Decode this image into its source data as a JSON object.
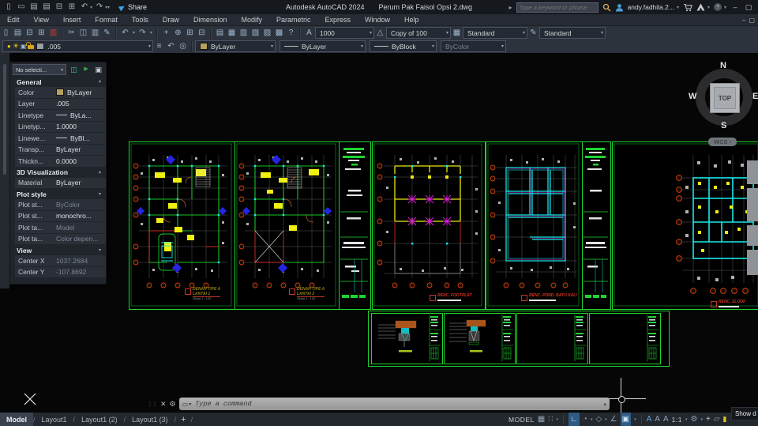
{
  "titlebar": {
    "share_label": "Share",
    "app_title": "Autodesk AutoCAD 2024",
    "doc_title": "Perum Pak Faisol Opsi 2.dwg",
    "search_placeholder": "Type a keyword or phrase",
    "user_name": "andy.fadhila.2..."
  },
  "menubar": {
    "items": [
      "Edit",
      "View",
      "Insert",
      "Format",
      "Tools",
      "Draw",
      "Dimension",
      "Modify",
      "Parametric",
      "Express",
      "Window",
      "Help"
    ]
  },
  "toolbar": {
    "dim_scale": "1000",
    "scale_list": "Copy of 100",
    "table_style": "Standard",
    "mleader_style": "Standard",
    "layer_name": ".005",
    "color": "ByLayer",
    "linetype": "ByLayer",
    "lineweight": "ByBlock",
    "plot_style": "ByColor"
  },
  "properties": {
    "selection": "No selecti...",
    "sections": [
      {
        "title": "General",
        "rows": [
          [
            "Color",
            "ByLayer"
          ],
          [
            "Layer",
            ".005"
          ],
          [
            "Linetype",
            "ByLa..."
          ],
          [
            "Linetyp...",
            "1.0000"
          ],
          [
            "Linewe...",
            "ByBl..."
          ],
          [
            "Transp...",
            "ByLayer"
          ],
          [
            "Thickn...",
            "0.0000"
          ]
        ]
      },
      {
        "title": "3D Visualization",
        "rows": [
          [
            "Material",
            "ByLayer"
          ]
        ]
      },
      {
        "title": "Plot style",
        "rows": [
          [
            "Plot st...",
            "ByColor"
          ],
          [
            "Plot st...",
            "monochro..."
          ],
          [
            "Plot ta...",
            "Model"
          ],
          [
            "Plot ta...",
            "Color depen..."
          ]
        ]
      },
      {
        "title": "View",
        "rows": [
          [
            "Center X",
            "1037.2684"
          ],
          [
            "Center Y",
            "-107.8692"
          ]
        ]
      }
    ]
  },
  "viewcube": {
    "north": "N",
    "west": "W",
    "east": "E",
    "south": "S",
    "face": "TOP",
    "wcs": "WCS"
  },
  "sheets": {
    "plan1": {
      "line1": "DENAH TIPE A",
      "line2": "LANTAI 1",
      "scale": "Skala 1 : 100"
    },
    "plan2": {
      "line1": "DENAH TIPE A",
      "line2": "LANTAI 2",
      "scale": "Skala 1 : 100"
    },
    "footplat": {
      "title": "RENC. FOOTPLAT"
    },
    "pondasi": {
      "title": "RENC. POND. BATU KALI"
    },
    "sloof": {
      "title": "RENC. SLOOF"
    }
  },
  "command": {
    "placeholder": "Type a command"
  },
  "statusbar": {
    "tabs": [
      "Model",
      "Layout1",
      "Layout1 (2)",
      "Layout1 (3)"
    ],
    "separator": "/",
    "model_space": "MODEL",
    "annotation_scale": "1:1",
    "tooltip": "Show d"
  },
  "icons": {
    "qnew": "▯",
    "open": "▭",
    "save": "▤",
    "save_as": "▤",
    "plot": "⊟",
    "preview": "⊞",
    "publish": "▥",
    "cut": "✂",
    "copy": "◫",
    "paste": "▥",
    "match": "✎",
    "undo": "↶",
    "redo": "↷",
    "pan": "+",
    "zoom": "⊕",
    "zoom_window": "⊞",
    "zoom_prev": "⊟",
    "props": "▤",
    "design_center": "▦",
    "tool_palettes": "▥",
    "sheet_set": "▧",
    "markup": "▨",
    "quickcalc": "▩",
    "help": "?",
    "text_style": "A",
    "dim_style": "△",
    "table_style": "▦",
    "mleader_style": "✎",
    "bulb": "●",
    "sun": "☀",
    "vp_freeze": "▣",
    "layer_props": "≡",
    "layer_prev": "↶",
    "layer_state": "◎",
    "chevron": "▾",
    "play": "▸",
    "share": "▶",
    "minimize": "–",
    "restore": "▢",
    "close": "✕",
    "wrench": "⚙",
    "cmd": "▭",
    "cmd_up": "▴",
    "dots": "⋮⋮",
    "help_q": "?",
    "grid": "▦",
    "snap": "∷",
    "ortho": "∟",
    "polar": "◔",
    "iso": "◇",
    "otrack": "∠",
    "osnap": "▣",
    "anno_vis": "A",
    "auto_scale": "A",
    "anno": "A",
    "gear": "⚙",
    "plus": "+",
    "isolate": "▱",
    "perf": "▮",
    "check": "✓",
    "toggle_value": "◫",
    "select_objects": "▶",
    "quick_select": "▣"
  },
  "colors": {
    "cad_green": "#1fd32f",
    "cad_yellow": "#f0f011",
    "cad_cyan": "#19e8e8",
    "cad_magenta": "#e819e8",
    "cad_red": "#cf2a1d",
    "bubble_red": "#cd3f10",
    "grid_gray": "#5a5a5a",
    "swatch_tan": "#b8a15e",
    "accent_blue": "#59a7e8"
  }
}
